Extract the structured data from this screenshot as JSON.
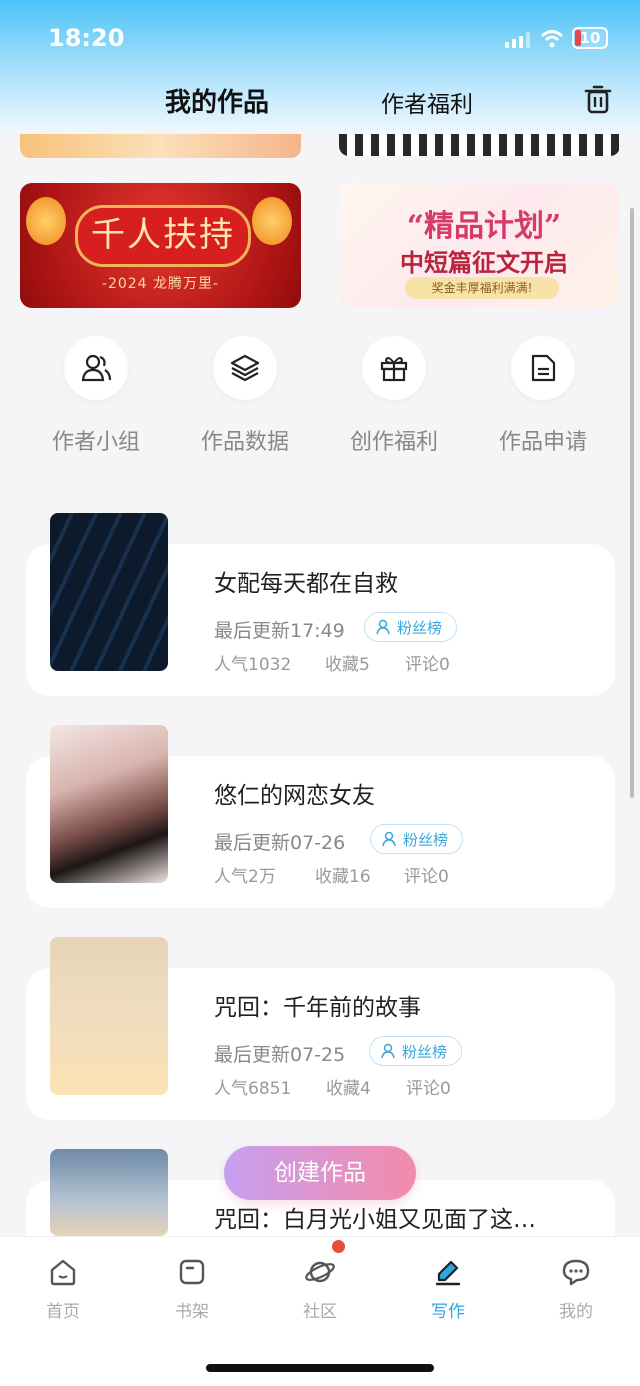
{
  "status": {
    "time": "18:20",
    "battery": "10"
  },
  "header": {
    "tab_works": "我的作品",
    "tab_welfare": "作者福利"
  },
  "banners": {
    "left": {
      "title": "千人扶持",
      "subtitle": "-2024 龙腾万里-"
    },
    "right": {
      "title": "“精品计划”",
      "subtitle": "中短篇征文开启",
      "tag": "奖金丰厚福利满满!"
    }
  },
  "quick": [
    {
      "label": "作者小组",
      "icon": "people-icon"
    },
    {
      "label": "作品数据",
      "icon": "layers-icon"
    },
    {
      "label": "创作福利",
      "icon": "gift-icon"
    },
    {
      "label": "作品申请",
      "icon": "document-icon"
    }
  ],
  "works": [
    {
      "title": "女配每天都在自救",
      "updated": "最后更新17:49",
      "fans": "粉丝榜",
      "popularity": "人气1032",
      "favorites": "收藏5",
      "comments": "评论0"
    },
    {
      "title": "悠仁的网恋女友",
      "updated": "最后更新07-26",
      "fans": "粉丝榜",
      "popularity": "人气2万",
      "favorites": "收藏16",
      "comments": "评论0"
    },
    {
      "title": "咒回：千年前的故事",
      "updated": "最后更新07-25",
      "fans": "粉丝榜",
      "popularity": "人气6851",
      "favorites": "收藏4",
      "comments": "评论0"
    },
    {
      "title": "咒回：白月光小姐又见面了这…"
    }
  ],
  "fab": "创建作品",
  "tabbar": [
    {
      "label": "首页",
      "icon": "home-icon"
    },
    {
      "label": "书架",
      "icon": "bookshelf-icon"
    },
    {
      "label": "社区",
      "icon": "planet-icon"
    },
    {
      "label": "写作",
      "icon": "pen-icon"
    },
    {
      "label": "我的",
      "icon": "chat-bubble-icon"
    }
  ],
  "colors": {
    "accent": "#2ea7e0",
    "fab_start": "#c79ff0",
    "fab_end": "#f48aa9",
    "badge": "#e84e3d"
  }
}
